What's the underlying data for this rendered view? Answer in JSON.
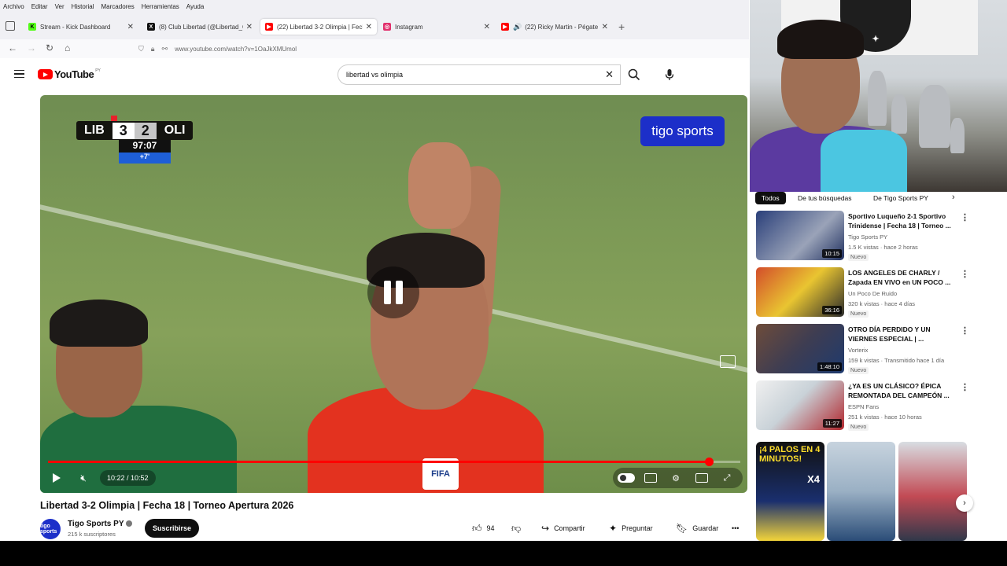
{
  "menubar": {
    "items": [
      "Archivo",
      "Editar",
      "Ver",
      "Historial",
      "Marcadores",
      "Herramientas",
      "Ayuda"
    ]
  },
  "tabs": [
    {
      "title": "Stream - Kick Dashboard",
      "favicon": "kick-icon",
      "color": "#53fc18"
    },
    {
      "title": "(8) Club Libertad (@Libertad_Gu",
      "favicon": "x-icon",
      "color": "#111111"
    },
    {
      "title": "(22) Libertad 3-2 Olimpia | Fech",
      "favicon": "youtube-icon",
      "color": "#ff0000",
      "active": true
    },
    {
      "title": "Instagram",
      "favicon": "instagram-icon",
      "color": "#e1306c"
    },
    {
      "title": "(22) Ricky Martin - Pégate -",
      "favicon": "youtube-icon",
      "color": "#ff0000",
      "audio": true
    }
  ],
  "navbar": {
    "url": "www.youtube.com/watch?v=1OaJkXMUmol"
  },
  "youtube": {
    "logo": "YouTube",
    "country": "PY",
    "search_value": "libertad vs olimpia"
  },
  "player": {
    "scoreboard": {
      "home": "LIB",
      "home_score": "3",
      "away_score": "2",
      "away": "OLI",
      "clock": "97:07",
      "added_time": "+7'"
    },
    "broadcaster": "tigo sports",
    "referee_badge": "FIFA",
    "time_display": "10:22 / 10:52",
    "progress": 0.9541
  },
  "video": {
    "title": "Libertad 3-2 Olimpia | Fecha 18 | Torneo Apertura 2026",
    "channel": "Tigo Sports PY",
    "avatar_text": "tigo sports",
    "subscribers": "215 k suscriptores",
    "subscribe_label": "Suscribirse",
    "likes": "94",
    "share_label": "Compartir",
    "ask_label": "Preguntar",
    "save_label": "Guardar"
  },
  "chips": [
    "Todos",
    "De tus búsquedas",
    "De Tigo Sports PY"
  ],
  "recommendations": [
    {
      "title": "Sportivo Luqueño 2-1 Sportivo Trinidense | Fecha 18 | Torneo ...",
      "channel": "Tigo Sports PY",
      "meta": "1.5 K vistas · hace 2 horas",
      "badge": "Nuevo",
      "duration": "10:15",
      "thumb_color": "#2a3f7a"
    },
    {
      "title": "LOS ANGELES DE CHARLY / Zapada EN VIVO en UN POCO ...",
      "channel": "Un Poco De Ruido",
      "meta": "320 k vistas · hace 4 días",
      "badge": "Nuevo",
      "duration": "36:16",
      "thumb_color": "#e9c531"
    },
    {
      "title": "OTRO DÍA PERDIDO Y UN VIERNES ESPECIAL | ...",
      "channel": "Vorterix",
      "meta": "159 k vistas · Transmitido hace 1 día",
      "badge": "Nuevo",
      "duration": "1:48:10",
      "thumb_color": "#3e3d52"
    },
    {
      "title": "¿YA ES UN CLÁSICO? ÉPICA REMONTADA DEL CAMPEÓN ...",
      "channel": "ESPN Fans",
      "meta": "251 k vistas · hace 10 horas",
      "badge": "Nuevo",
      "duration": "11:27",
      "thumb_color": "#c9d2d8"
    }
  ],
  "shorts": [
    {
      "caption": "¡4 PALOS EN 4 MINUTOS!",
      "overlay": "X4",
      "color": "#1a2f6e"
    },
    {
      "caption": "",
      "overlay": "",
      "color": "#9ab0c4"
    },
    {
      "caption": "",
      "overlay": "",
      "color": "#c24a54"
    }
  ]
}
